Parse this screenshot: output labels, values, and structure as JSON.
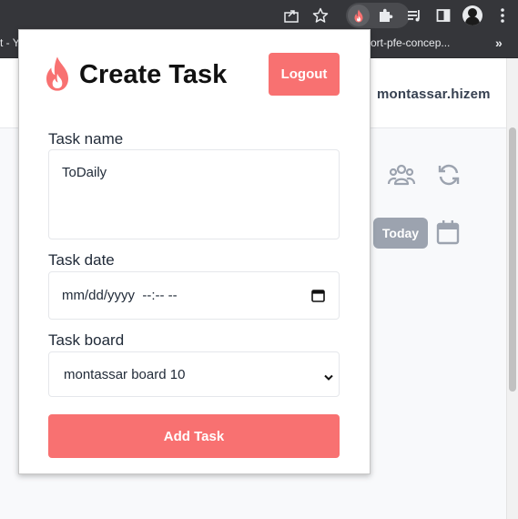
{
  "browser": {
    "bookmark_left": "t - Yo",
    "bookmark_right": "ort-pfe-concep...",
    "more_chevrons": "»",
    "icons": [
      "share-icon",
      "star-icon",
      "fire-extension-icon",
      "puzzle-icon",
      "media-playlist-icon",
      "sidepanel-icon",
      "profile-avatar",
      "kebab-menu-icon"
    ]
  },
  "page": {
    "username": "montassar.hizem",
    "today_label": "Today"
  },
  "popup": {
    "title": "Create Task",
    "logout_label": "Logout",
    "task_name_label": "Task name",
    "task_name_value": "ToDaily",
    "task_date_label": "Task date",
    "task_date_placeholder": "mm/dd/yyyy  --:-- --",
    "task_board_label": "Task board",
    "task_board_value": "montassar board 10",
    "add_label": "Add Task"
  },
  "colors": {
    "accent": "#f87171",
    "chrome": "#35363a",
    "muted_icon": "#9ca3af"
  }
}
